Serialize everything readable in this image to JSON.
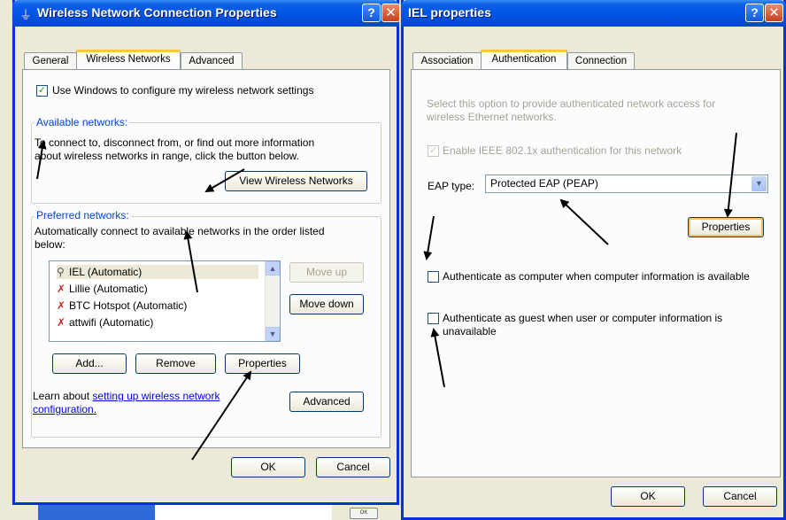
{
  "background": {
    "ok_fragment": "OK"
  },
  "left_window": {
    "title": "Wireless Network Connection Properties",
    "tabs": [
      "General",
      "Wireless Networks",
      "Advanced"
    ],
    "use_windows_label": "Use Windows to configure my wireless network settings",
    "available": {
      "label": "Available networks:",
      "description_1": "To connect to, disconnect from, or find out more information",
      "description_2": "about wireless networks in range, click the button below.",
      "view_button": "View Wireless Networks"
    },
    "preferred": {
      "label": "Preferred networks:",
      "description_1": "Automatically connect to available networks in the order listed",
      "description_2": "below:",
      "networks": [
        "IEL (Automatic)",
        "Lillie (Automatic)",
        "BTC Hotspot (Automatic)",
        "attwifi (Automatic)"
      ],
      "move_up": "Move up",
      "move_down": "Move down",
      "add": "Add...",
      "remove": "Remove",
      "properties": "Properties"
    },
    "learn_prefix": "Learn about ",
    "learn_link_1": "setting up wireless network",
    "learn_link_2": "configuration.",
    "advanced_button": "Advanced",
    "ok": "OK",
    "cancel": "Cancel"
  },
  "right_window": {
    "title": "IEL properties",
    "tabs": [
      "Association",
      "Authentication",
      "Connection"
    ],
    "info_1": "Select this option to provide authenticated network access for",
    "info_2": "wireless Ethernet networks.",
    "enable_8021x": "Enable IEEE 802.1x authentication for this network",
    "eap_label": "EAP type:",
    "eap_value": "Protected EAP (PEAP)",
    "properties": "Properties",
    "auth_computer": "Authenticate as computer when computer information is available",
    "auth_guest_1": "Authenticate as guest when user or computer information is",
    "auth_guest_2": "unavailable",
    "ok": "OK",
    "cancel": "Cancel"
  }
}
